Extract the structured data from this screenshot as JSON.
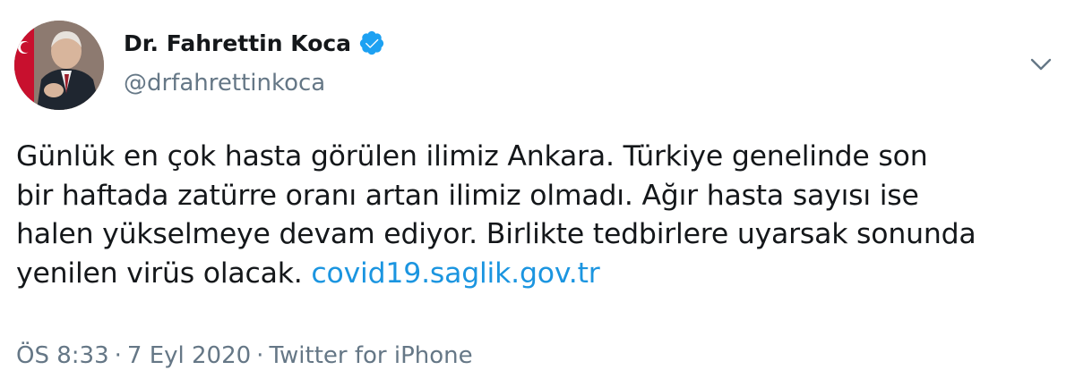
{
  "author": {
    "display_name": "Dr. Fahrettin Koca",
    "handle": "@drfahrettinkoca",
    "verified_icon": "verified-badge-icon"
  },
  "tweet": {
    "text": "Günlük en çok hasta görülen ilimiz Ankara. Türkiye genelinde son\nbir haftada zatürre oranı artan ilimiz olmadı. Ağır hasta sayısı ise\nhalen yükselmeye devam ediyor. Birlikte tedbirlere uyarsak sonunda\nyenilen virüs olacak. ",
    "link_text": "covid19.saglik.gov.tr"
  },
  "meta": {
    "time": "ÖS 8:33",
    "separator": "·",
    "date": "7 Eyl 2020",
    "source": "Twitter for iPhone"
  },
  "colors": {
    "text": "#14171a",
    "secondary": "#657786",
    "link": "#1b95e0",
    "verified": "#1da1f2"
  },
  "icons": {
    "menu": "chevron-down-icon"
  }
}
